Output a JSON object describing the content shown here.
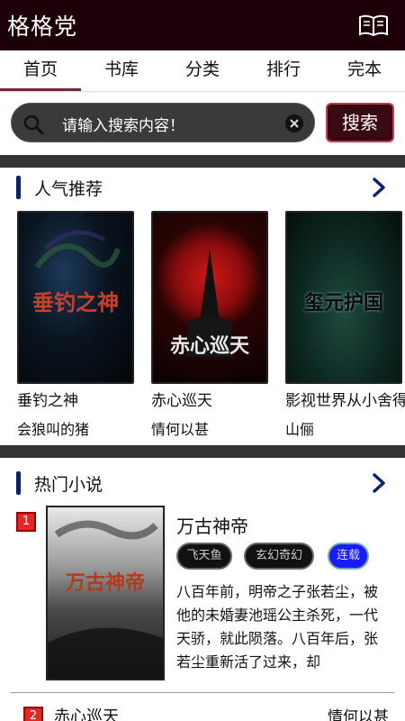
{
  "app": {
    "title": "格格党"
  },
  "tabs": [
    {
      "label": "首页"
    },
    {
      "label": "书库"
    },
    {
      "label": "分类"
    },
    {
      "label": "排行"
    },
    {
      "label": "完本"
    }
  ],
  "search": {
    "placeholder": "请输入搜索内容！",
    "button_label": "搜索"
  },
  "popular": {
    "title": "人气推荐",
    "books": [
      {
        "title": "垂钓之神",
        "author": "会狼叫的猪",
        "cover_text": "垂钓之神"
      },
      {
        "title": "赤心巡天",
        "author": "情何以甚",
        "cover_text": "赤心巡天"
      },
      {
        "title": "影视世界从小舍得开始",
        "author": "山俪",
        "cover_text": "玺元护国"
      }
    ]
  },
  "hot": {
    "title": "热门小说",
    "items": [
      {
        "rank": "1",
        "title": "万古神帝",
        "tags": [
          "飞天鱼",
          "玄幻奇幻",
          "连载"
        ],
        "description": "八百年前，明帝之子张若尘，被他的未婚妻池瑶公主杀死，一代天骄，就此陨落。八百年后，张若尘重新活了过来，却",
        "cover_text": "万古神帝"
      },
      {
        "rank": "2",
        "title": "赤心巡天",
        "author": "情何以甚"
      }
    ]
  },
  "colors": {
    "header_bg": "#1c0208",
    "accent": "#6e2a35",
    "section_bar": "#0d1f6b",
    "rank_badge": "#e52727",
    "tag_blue": "#1a1aff"
  }
}
